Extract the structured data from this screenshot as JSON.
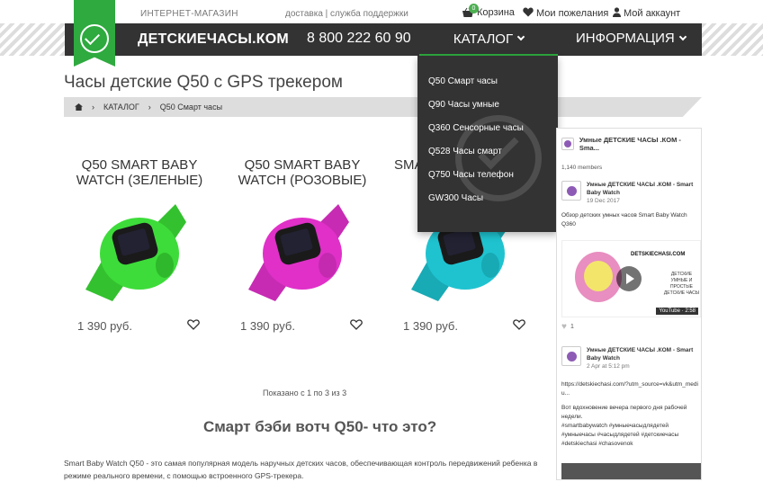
{
  "topbar": {
    "shop_label": "ИНТЕРНЕТ-МАГАЗИН",
    "delivery_label": "доставка | служба поддержки",
    "cart_label": "Корзина",
    "cart_count": "0",
    "wishlist_label": "Мои пожелания",
    "account_label": "Мой аккаунт"
  },
  "nav": {
    "brand": "ДЕТСКИЕЧАСЫ.КОМ",
    "phone": "8 800 222 60 90",
    "catalog_label": "КАТАЛОГ",
    "info_label": "ИНФОРМАЦИЯ"
  },
  "catalog_menu": [
    "Q50 Смарт часы",
    "Q90 Часы умные",
    "Q360 Сенсорные часы",
    "Q528 Часы смарт",
    "Q750 Часы телефон",
    "GW300 Часы"
  ],
  "page": {
    "title": "Часы детские Q50 с GPS трекером",
    "breadcrumb": [
      "КАТАЛОГ",
      "Q50 Смарт часы"
    ]
  },
  "products": [
    {
      "name": "Q50 SMART BABY\nWATCH (ЗЕЛЕНЫЕ)",
      "price": "1 390 руб.",
      "color": "#3ddc3a"
    },
    {
      "name": "Q50 SMART BABY\nWATCH (РОЗОВЫЕ)",
      "price": "1 390 руб.",
      "color": "#e030c8"
    },
    {
      "name": "SMA",
      "price": "1 390 руб.",
      "color": "#1fc3d0"
    }
  ],
  "listing": {
    "shown_text": "Показано с 1 по 3 из 3",
    "subtitle": "Смарт бэби вотч Q50- что это?",
    "description": "Smart Baby Watch Q50 - это самая популярная модель наручных детских часов, обеспечивающая контроль передвижений ребенка в режиме реального времени, с помощью встроенного GPS-трекера."
  },
  "widget": {
    "group_name": "Умные ДЕТСКИЕ ЧАСЫ .КОМ - Sma...",
    "members": "1,140 members",
    "post1": {
      "author": "Умные ДЕТСКИЕ ЧАСЫ .КОМ - Smart Baby Watch",
      "date": "19 Dec 2017",
      "text": "Обзор детских умных часов Smart Baby Watch Q360",
      "video_title": "DETSKIECHASI.COM",
      "video_text": "ДЕТСКИЕ\nУМНЫЕ И ПРОСТЫЕ\nДЕТСКИЕ ЧАСЫ",
      "duration": "YouTube · 2:58",
      "likes": "1"
    },
    "post2": {
      "author": "Умные ДЕТСКИЕ ЧАСЫ .КОМ - Smart Baby Watch",
      "date": "2 Apr at 5:12 pm",
      "link": "https://detskiechasi.com/?utm_source=vk&utm_mediu...",
      "text": "Вот вдохновение вечера первого дня рабочей недели.",
      "tags": "#smartbabywatch #умныечасыдлядетей #умныечасы #часыдлядетей #детскиечасы #detskiechasi #chasovenok"
    }
  },
  "colors": {
    "accent": "#2eaa3f",
    "navbar": "#333333"
  }
}
